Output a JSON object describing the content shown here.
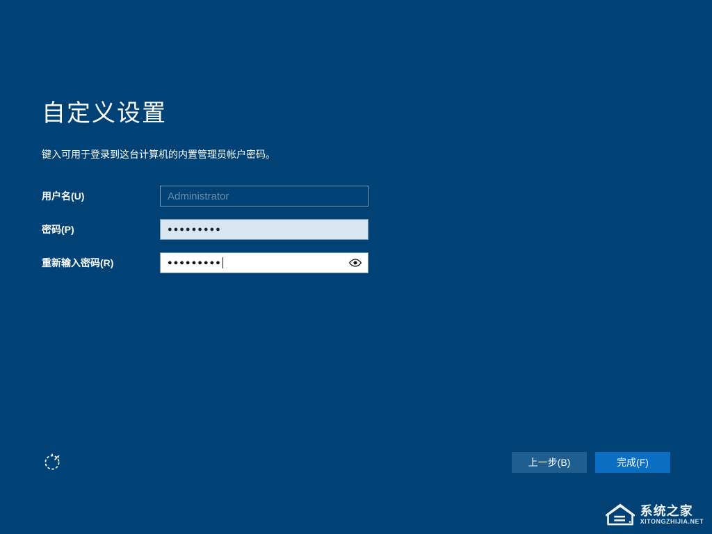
{
  "page": {
    "title": "自定义设置",
    "subtitle": "键入可用于登录到这台计算机的内置管理员帐户密码。"
  },
  "form": {
    "username_label": "用户名(U)",
    "username_value": "Administrator",
    "password_label": "密码(P)",
    "password_mask": "●●●●●●●●●",
    "confirm_label": "重新输入密码(R)",
    "confirm_mask": "●●●●●●●●●"
  },
  "footer": {
    "back_label": "上一步(B)",
    "finish_label": "完成(F)"
  },
  "watermark": {
    "name": "系统之家",
    "url": "XITONGZHIJIA.NET"
  }
}
